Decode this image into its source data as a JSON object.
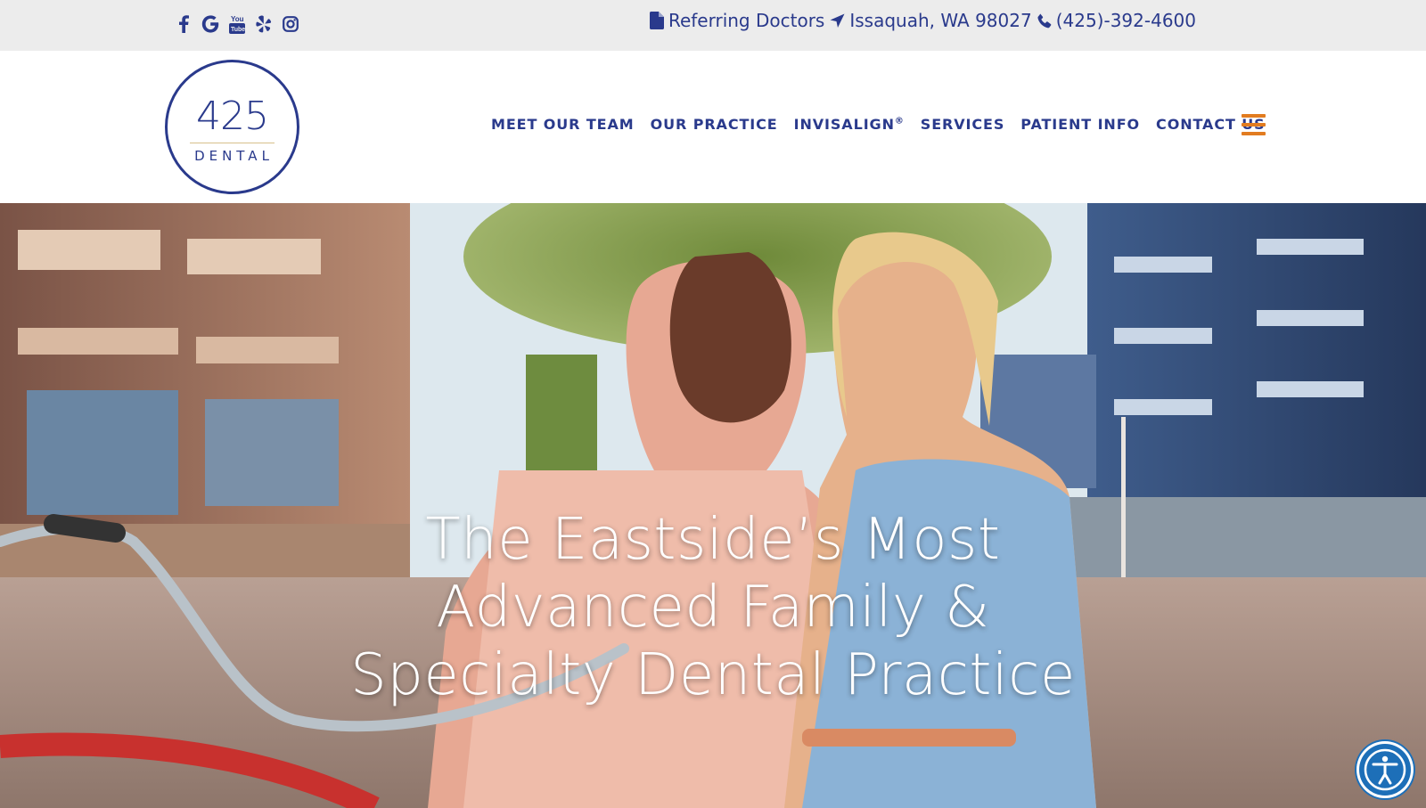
{
  "topbar": {
    "social_icons": [
      "facebook-icon",
      "google-icon",
      "youtube-icon",
      "yelp-icon",
      "instagram-icon"
    ],
    "youtube_text": "You Tube",
    "referring_label": "Referring Doctors",
    "location_label": "Issaquah, WA 98027",
    "phone_label": "(425)-392-4600"
  },
  "logo": {
    "number": "425",
    "word": "DENTAL"
  },
  "nav": {
    "items": [
      {
        "label": "MEET OUR TEAM"
      },
      {
        "label": "OUR PRACTICE"
      },
      {
        "label": "INVISALIGN",
        "sup": "®"
      },
      {
        "label": "SERVICES"
      },
      {
        "label": "PATIENT INFO"
      },
      {
        "label": "CONTACT US"
      }
    ],
    "menu_icon": "hamburger-menu-icon"
  },
  "hero": {
    "title_lines": [
      "The Eastside’s Most",
      "Advanced Family &",
      "Specialty Dental Practice"
    ]
  },
  "accessibility": {
    "icon": "accessibility-icon"
  },
  "colors": {
    "brand_navy": "#2a3a8c",
    "accent_orange": "#e27c20",
    "topbar_bg": "#ececec",
    "logo_gold": "#d7c08b",
    "accessibility_blue": "#1d6fb8"
  }
}
